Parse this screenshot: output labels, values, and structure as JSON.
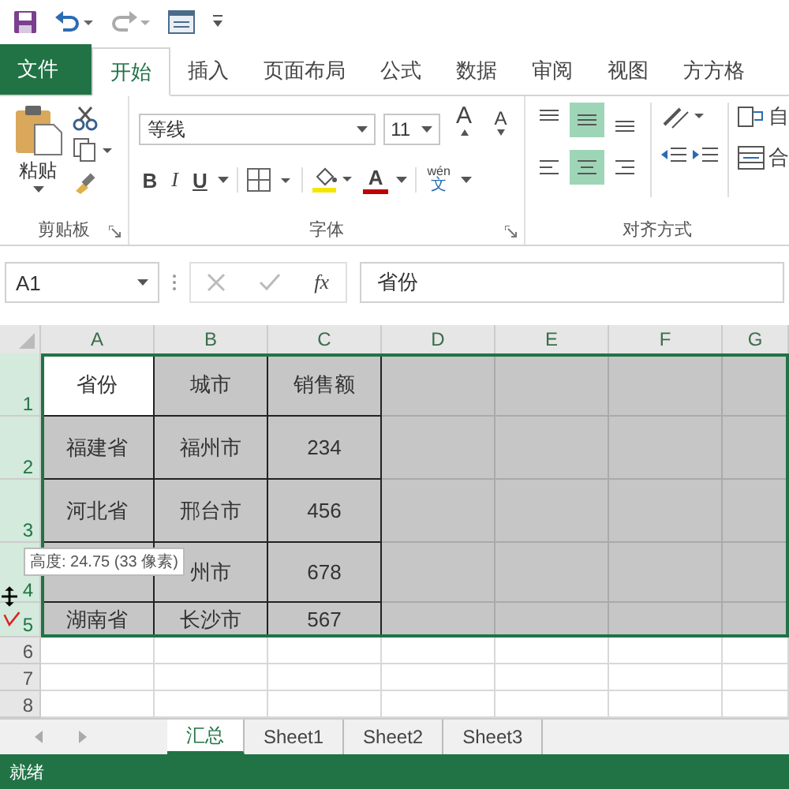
{
  "tabs": [
    {
      "label": "文件",
      "kind": "file",
      "selected": false
    },
    {
      "label": "开始",
      "kind": "tab",
      "selected": true
    },
    {
      "label": "插入",
      "kind": "tab",
      "selected": false
    },
    {
      "label": "页面布局",
      "kind": "tab",
      "selected": false
    },
    {
      "label": "公式",
      "kind": "tab",
      "selected": false
    },
    {
      "label": "数据",
      "kind": "tab",
      "selected": false
    },
    {
      "label": "审阅",
      "kind": "tab",
      "selected": false
    },
    {
      "label": "视图",
      "kind": "tab",
      "selected": false
    },
    {
      "label": "方方格",
      "kind": "tab",
      "selected": false
    }
  ],
  "ribbon": {
    "paste_label": "粘贴",
    "clipboard_label": "剪贴板",
    "font_name": "等线",
    "font_size": "11",
    "grow_font": "A",
    "shrink_font": "A",
    "bold": "B",
    "italic": "I",
    "underline": "U",
    "font_color": "A",
    "phonetic_top": "wén",
    "phonetic_bottom": "文",
    "font_label": "字体",
    "vertical_align": [
      {
        "selected": false
      },
      {
        "selected": true
      },
      {
        "selected": false
      }
    ],
    "horizontal_align": [
      {
        "selected": false
      },
      {
        "selected": true
      },
      {
        "selected": false
      }
    ],
    "wrap_label": "自",
    "merge_label": "合",
    "alignment_label": "对齐方式"
  },
  "formula_bar": {
    "name_box": "A1",
    "fx": "fx",
    "value": "省份"
  },
  "grid": {
    "columns": [
      "A",
      "B",
      "C",
      "D",
      "E",
      "F",
      "G"
    ],
    "rows": [
      {
        "header": "1",
        "selected": true,
        "cells": [
          {
            "text": "省份",
            "active": true
          },
          {
            "text": "城市",
            "active": false
          },
          {
            "text": "销售额",
            "active": false
          }
        ]
      },
      {
        "header": "2",
        "selected": true,
        "cells": [
          {
            "text": "福建省",
            "active": false
          },
          {
            "text": "福州市",
            "active": false
          },
          {
            "text": "234",
            "active": false
          }
        ]
      },
      {
        "header": "3",
        "selected": true,
        "cells": [
          {
            "text": "河北省",
            "active": false
          },
          {
            "text": "邢台市",
            "active": false
          },
          {
            "text": "456",
            "active": false
          }
        ]
      },
      {
        "header": "4",
        "selected": true,
        "cells": [
          {
            "active": false
          },
          {
            "text": "州市",
            "active": false
          },
          {
            "text": "678",
            "active": false
          }
        ]
      },
      {
        "header": "5",
        "selected": true,
        "cells": [
          {
            "text": "湖南省",
            "active": false
          },
          {
            "text": "长沙市",
            "active": false
          },
          {
            "text": "567",
            "active": false
          }
        ]
      },
      {
        "header": "6",
        "selected": false,
        "cells": []
      },
      {
        "header": "7",
        "selected": false,
        "cells": []
      },
      {
        "header": "8",
        "selected": false,
        "cells": []
      }
    ]
  },
  "tooltip": "高度: 24.75 (33 像素)",
  "sheet_tabs": [
    {
      "label": "汇总",
      "selected": true
    },
    {
      "label": "Sheet1",
      "selected": false
    },
    {
      "label": "Sheet2",
      "selected": false
    },
    {
      "label": "Sheet3",
      "selected": false
    }
  ],
  "status_bar": "就绪"
}
